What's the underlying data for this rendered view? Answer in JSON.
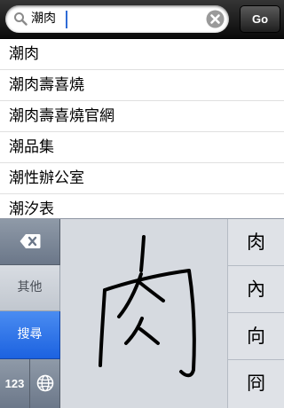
{
  "search": {
    "query": "潮肉",
    "go_label": "Go",
    "icon": "magnifier-icon",
    "clear_icon": "clear-x-icon"
  },
  "suggestions": [
    "潮肉",
    "潮肉壽喜燒",
    "潮肉壽喜燒官網",
    "潮品集",
    "潮性辦公室",
    "潮汐表"
  ],
  "keyboard": {
    "delete_icon": "backspace-icon",
    "other_label": "其他",
    "search_label": "搜尋",
    "numbers_label": "123",
    "globe_icon": "globe-icon",
    "handwritten_character": "肉",
    "candidates": [
      "肉",
      "內",
      "向",
      "冏"
    ],
    "colors": {
      "search_key": "#2a6fe8",
      "function_key": "#7a8597",
      "pad": "#d6dae0"
    }
  }
}
